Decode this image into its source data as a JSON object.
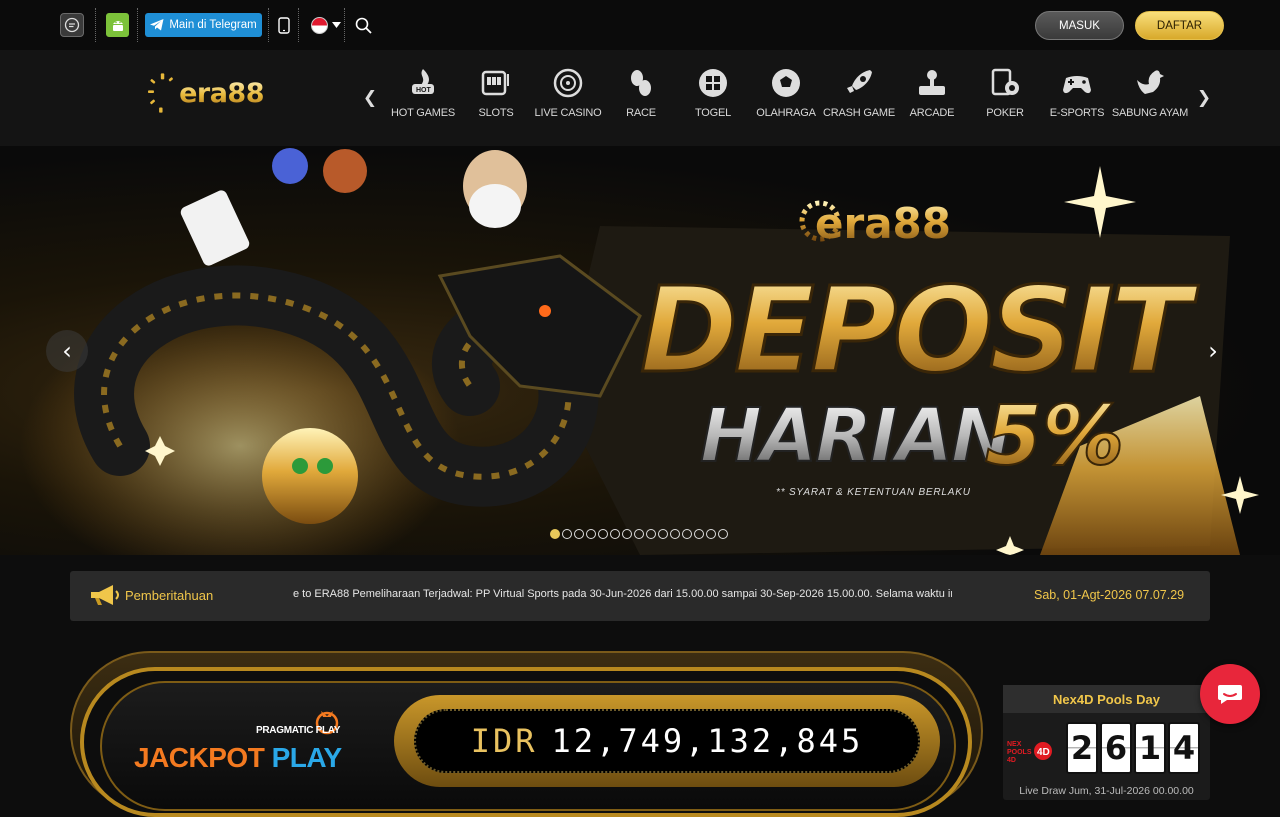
{
  "topbar": {
    "telegram_label": "Main di Telegram",
    "login_label": "MASUK",
    "register_label": "DAFTAR"
  },
  "brand": {
    "logo_text": "era88"
  },
  "nav": {
    "items": [
      {
        "label": "HOT GAMES",
        "icon": "hot-games-icon"
      },
      {
        "label": "SLOTS",
        "icon": "slots-icon"
      },
      {
        "label": "LIVE CASINO",
        "icon": "live-casino-icon"
      },
      {
        "label": "RACE",
        "icon": "race-icon"
      },
      {
        "label": "TOGEL",
        "icon": "togel-icon"
      },
      {
        "label": "OLAHRAGA",
        "icon": "soccer-ball-icon"
      },
      {
        "label": "CRASH GAME",
        "icon": "rocket-icon"
      },
      {
        "label": "ARCADE",
        "icon": "arcade-icon"
      },
      {
        "label": "POKER",
        "icon": "poker-icon"
      },
      {
        "label": "E-SPORTS",
        "icon": "gamepad-icon"
      },
      {
        "label": "SABUNG AYAM",
        "icon": "rooster-icon"
      }
    ]
  },
  "banner": {
    "brand": "era88",
    "headline": "DEPOSIT",
    "subheadline": "HARIAN",
    "percent": "5%",
    "disclaimer": "** SYARAT & KETENTUAN BERLAKU",
    "slide_count": 15,
    "active_slide": 1
  },
  "announcement": {
    "title": "Pemberitahuan",
    "marquee": "e to ERA88      Pemeliharaan Terjadwal: PP Virtual Sports pada 30-Jun-2026 dari 15.00.00 sampai 30-Sep-2026 15.00.00. Selama waktu ini, PP Virtual Sports",
    "datetime": "Sab, 01-Agt-2026 07.07.29"
  },
  "jackpot": {
    "provider": "PRAGMATIC PLAY",
    "title_part1": "JACKPOT",
    "title_part2": "PLAY",
    "currency": "IDR",
    "amount": "12,749,132,845"
  },
  "pools": {
    "title": "Nex4D Pools Day",
    "logo_text": "NEX POOLS 4D",
    "digits": [
      "2",
      "6",
      "1",
      "4"
    ],
    "draw_date": "Live Draw Jum, 31-Jul-2026 00.00.00"
  },
  "colors": {
    "accent_gold": "#f0c64a",
    "telegram_blue": "#1f8fd6",
    "chat_red": "#e8263b",
    "android_green": "#7cc23a"
  }
}
